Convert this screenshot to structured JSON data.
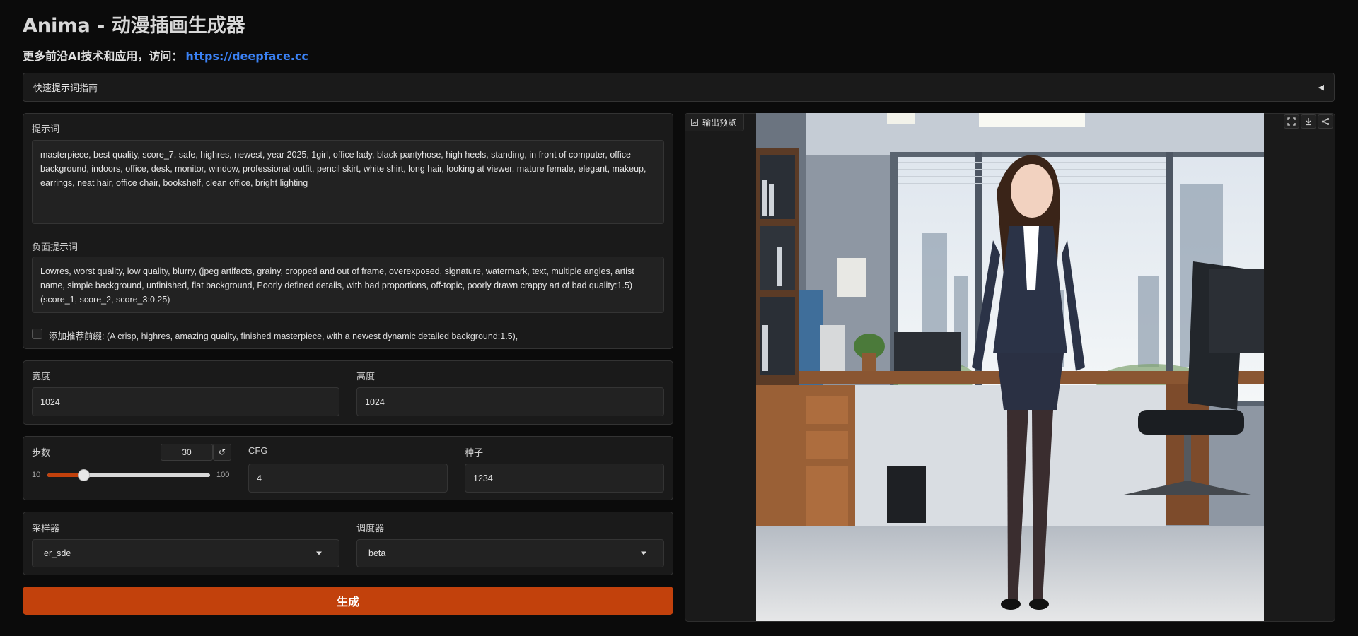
{
  "header": {
    "title": "Anima - 动漫插画生成器",
    "subtitle_prefix": "更多前沿AI技术和应用，访问：",
    "subtitle_link": "https://deepface.cc"
  },
  "accordion": {
    "label": "快速提示词指南",
    "arrow": "◀"
  },
  "prompt": {
    "label": "提示词",
    "value": "masterpiece, best quality, score_7, safe, highres, newest, year 2025, 1girl, office lady, black pantyhose, high heels, standing, in front of computer, office background, indoors, office, desk, monitor, window, professional outfit, pencil skirt, white shirt, long hair, looking at viewer, mature female, elegant, makeup, earrings, neat hair, office chair, bookshelf, clean office, bright lighting"
  },
  "negative_prompt": {
    "label": "负面提示词",
    "value": "Lowres, worst quality, low quality, blurry, (jpeg artifacts, grainy, cropped and out of frame, overexposed, signature, watermark, text, multiple angles, artist name, simple background, unfinished, flat background, Poorly defined details, with bad proportions, off-topic, poorly drawn crappy art of bad quality:1.5) (score_1, score_2, score_3:0.25)"
  },
  "prefix_checkbox": {
    "label": "添加推荐前缀: (A crisp, highres, amazing quality, finished masterpiece, with a newest dynamic detailed background:1.5),",
    "checked": false
  },
  "size": {
    "width_label": "宽度",
    "width_value": "1024",
    "height_label": "高度",
    "height_value": "1024"
  },
  "steps": {
    "label": "步数",
    "value": "30",
    "min": "10",
    "max": "100",
    "fraction": 0.222,
    "reset_icon": "↺"
  },
  "cfg": {
    "label": "CFG",
    "value": "4"
  },
  "seed": {
    "label": "种子",
    "value": "1234"
  },
  "sampler": {
    "label": "采样器",
    "value": "er_sde"
  },
  "scheduler": {
    "label": "调度器",
    "value": "beta"
  },
  "generate_label": "生成",
  "output": {
    "label": "输出预览",
    "icons": [
      "image-icon",
      "fullscreen-icon",
      "download-icon",
      "share-icon"
    ]
  },
  "colors": {
    "accent": "#c2410c",
    "link": "#3b82f6",
    "panel": "#1a1a1a",
    "background": "#0b0b0b"
  }
}
